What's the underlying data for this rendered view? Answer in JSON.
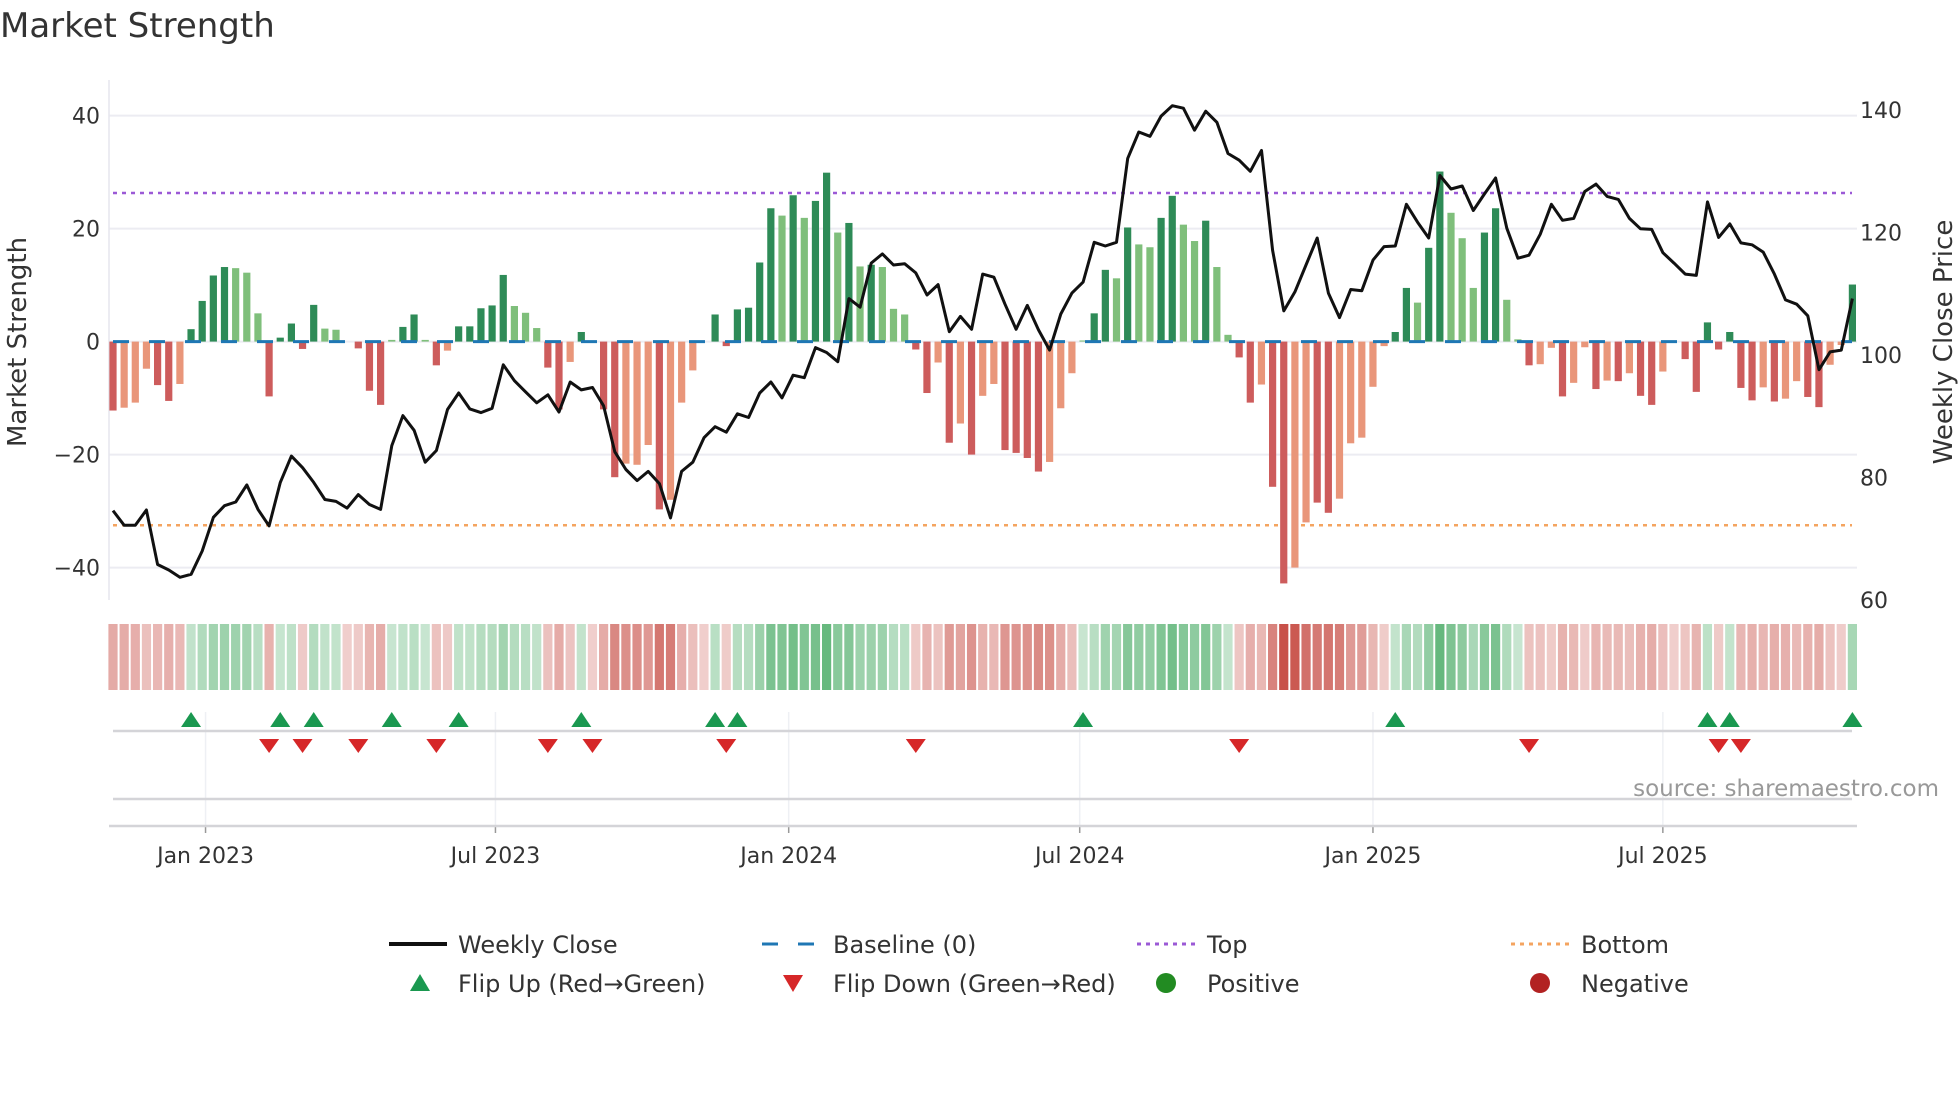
{
  "chart_data": {
    "type": "bar",
    "title": "Market Strength",
    "ylabel": "Market Strength",
    "y2label": "Weekly Close Price",
    "ylim": [
      -46,
      46
    ],
    "y2lim": [
      60,
      140
    ],
    "yticks": [
      40,
      20,
      0,
      -20,
      -40
    ],
    "y2ticks": [
      140,
      120,
      100,
      80,
      60
    ],
    "x_tick_labels": [
      {
        "label": "Jan 2023",
        "week_index": 8.3
      },
      {
        "label": "Jul 2023",
        "week_index": 34.3
      },
      {
        "label": "Jan 2024",
        "week_index": 60.6
      },
      {
        "label": "Jul 2024",
        "week_index": 86.7
      },
      {
        "label": "Jan 2025",
        "week_index": 113.0
      },
      {
        "label": "Jul 2025",
        "week_index": 139.0
      }
    ],
    "top_level": 26.3,
    "bottom_level": -32.5,
    "baseline": 0,
    "strength_values": [
      -12.2,
      -11.7,
      -10.8,
      -4.8,
      -7.7,
      -10.5,
      -7.5,
      2.2,
      7.2,
      11.7,
      13.2,
      13,
      12.2,
      5,
      -9.7,
      0.7,
      3.2,
      -1.3,
      6.5,
      2.3,
      2.1,
      0,
      -1.2,
      -8.7,
      -11.2,
      0.3,
      2.6,
      4.8,
      0.3,
      -4.2,
      -1.6,
      2.7,
      2.7,
      5.9,
      6.4,
      11.8,
      6.3,
      5.1,
      2.4,
      -4.6,
      -12,
      -3.6,
      1.7,
      0,
      -12,
      -24,
      -21.6,
      -21.8,
      -18.3,
      -29.7,
      -28,
      -10.8,
      -5.1,
      0,
      4.8,
      -0.8,
      5.7,
      6,
      14,
      23.6,
      22.3,
      25.9,
      21.9,
      24.9,
      29.9,
      19.3,
      21,
      13.3,
      13.6,
      13.2,
      5.8,
      4.8,
      -1.4,
      -9.1,
      -3.7,
      -17.9,
      -14.5,
      -20,
      -9.6,
      -7.5,
      -19.2,
      -19.7,
      -20.6,
      -23,
      -21.3,
      -11.8,
      -5.6,
      0.2,
      5,
      12.7,
      11.2,
      20.2,
      17.2,
      16.7,
      21.9,
      25.8,
      20.7,
      17.8,
      21.4,
      13.2,
      1.2,
      -2.8,
      -10.8,
      -7.6,
      -25.7,
      -42.8,
      -40,
      -32,
      -28.5,
      -30.3,
      -27.8,
      -18,
      -17,
      -8,
      -0.8,
      1.7,
      9.5,
      6.9,
      16.6,
      30.1,
      22.8,
      18.3,
      9.5,
      19.3,
      23.6,
      7.4,
      0.4,
      -4.2,
      -4,
      -1.1,
      -9.7,
      -7.3,
      -1,
      -8.4,
      -6.9,
      -7,
      -5.6,
      -9.6,
      -11.2,
      -5.3,
      0,
      -3.1,
      -8.9,
      3.4,
      -1.4,
      1.7,
      -8.2,
      -10.4,
      -8.1,
      -10.6,
      -10.1,
      -7,
      -9.8,
      -11.6,
      -4.1,
      -0.6,
      10.1
    ],
    "strength_shade": "RrrrRRrGGGGgggRGGRGgggRRRgGGgRrGGGGGgggRRrGgRRrrrRrrrrGRGGGGgGgGGgGgGgggRRrRrRrrRRRRrrrgGGgGggGGggGggRRrRRrrRRrrrrrGGgGGgggGGggRrrRrrRrRrRRrrRRGRGRRrRrrRRrrG",
    "weekly_close": [
      74.6,
      72.2,
      72.2,
      74.7,
      65.8,
      64.9,
      63.7,
      64.2,
      68,
      73.5,
      75.4,
      76,
      78.8,
      74.8,
      72.1,
      79.2,
      83.5,
      81.6,
      79.2,
      76.4,
      76.1,
      75,
      77.2,
      75.6,
      74.8,
      85.2,
      90.1,
      87.7,
      82.5,
      84.4,
      91.1,
      93.8,
      91.2,
      90.6,
      91.3,
      98.4,
      95.8,
      94,
      92.2,
      93.5,
      90.7,
      95.6,
      94.3,
      94.7,
      91.7,
      84.2,
      81.3,
      79.5,
      81,
      79,
      73.4,
      81,
      82.5,
      86.5,
      88.3,
      87.4,
      90.4,
      89.8,
      93.8,
      95.6,
      93,
      96.7,
      96.3,
      101.2,
      100.4,
      98.9,
      109.2,
      107.8,
      115,
      116.5,
      114.7,
      114.9,
      113.4,
      109.8,
      111.5,
      103.8,
      106.3,
      104.2,
      113.2,
      112.7,
      108.3,
      104.2,
      108.1,
      104.1,
      100.8,
      106.7,
      110.1,
      111.9,
      118.4,
      117.8,
      118.4,
      132.1,
      136.4,
      135.7,
      139,
      140.7,
      140.3,
      136.7,
      139.8,
      138,
      132.9,
      131.8,
      130,
      133.4,
      117.1,
      107.2,
      110.3,
      114.7,
      119.1,
      110.1,
      106.1,
      110.7,
      110.5,
      115.5,
      117.7,
      117.8,
      124.6,
      121.7,
      119.1,
      129.3,
      127.1,
      127.6,
      123.6,
      126.3,
      128.9,
      120.7,
      115.8,
      116.3,
      119.7,
      124.6,
      122,
      122.3,
      126.7,
      127.9,
      125.9,
      125.4,
      122.3,
      120.6,
      120.5,
      116.7,
      115,
      113.2,
      113,
      125,
      119.2,
      121.4,
      118.3,
      118,
      116.8,
      113.2,
      109,
      108.3,
      106.4,
      97.6,
      100.5,
      100.8,
      109.2
    ],
    "flip_up_weeks": [
      7,
      15,
      18,
      25,
      31,
      42,
      54,
      56,
      87,
      115,
      143,
      145,
      156
    ],
    "flip_down_weeks": [
      14,
      17,
      22,
      29,
      39,
      43,
      55,
      72,
      101,
      127,
      144,
      146
    ],
    "legend": [
      {
        "label": "Weekly Close",
        "kind": "line"
      },
      {
        "label": "Baseline (0)",
        "kind": "dash"
      },
      {
        "label": "Top",
        "kind": "dot-top"
      },
      {
        "label": "Bottom",
        "kind": "dot-bottom"
      },
      {
        "label": "Flip Up (Red→Green)",
        "kind": "tri-up"
      },
      {
        "label": "Flip Down (Green→Red)",
        "kind": "tri-down"
      },
      {
        "label": "Positive",
        "kind": "dot-pos"
      },
      {
        "label": "Negative",
        "kind": "dot-neg"
      }
    ],
    "legend_placement": "bottom",
    "source": "source: sharemaestro.com",
    "colors": {
      "strong_green": "#2e8b57",
      "weak_green": "#7fbf7b",
      "strong_red": "#cd5c5c",
      "weak_red": "#e9967a",
      "baseline": "#1f77b4",
      "top": "#9b59d6",
      "bottom": "#f4a460",
      "close": "#111111",
      "flip_up": "#1a9850",
      "flip_down": "#d62728",
      "positive": "#228b22",
      "negative": "#b22222"
    }
  }
}
